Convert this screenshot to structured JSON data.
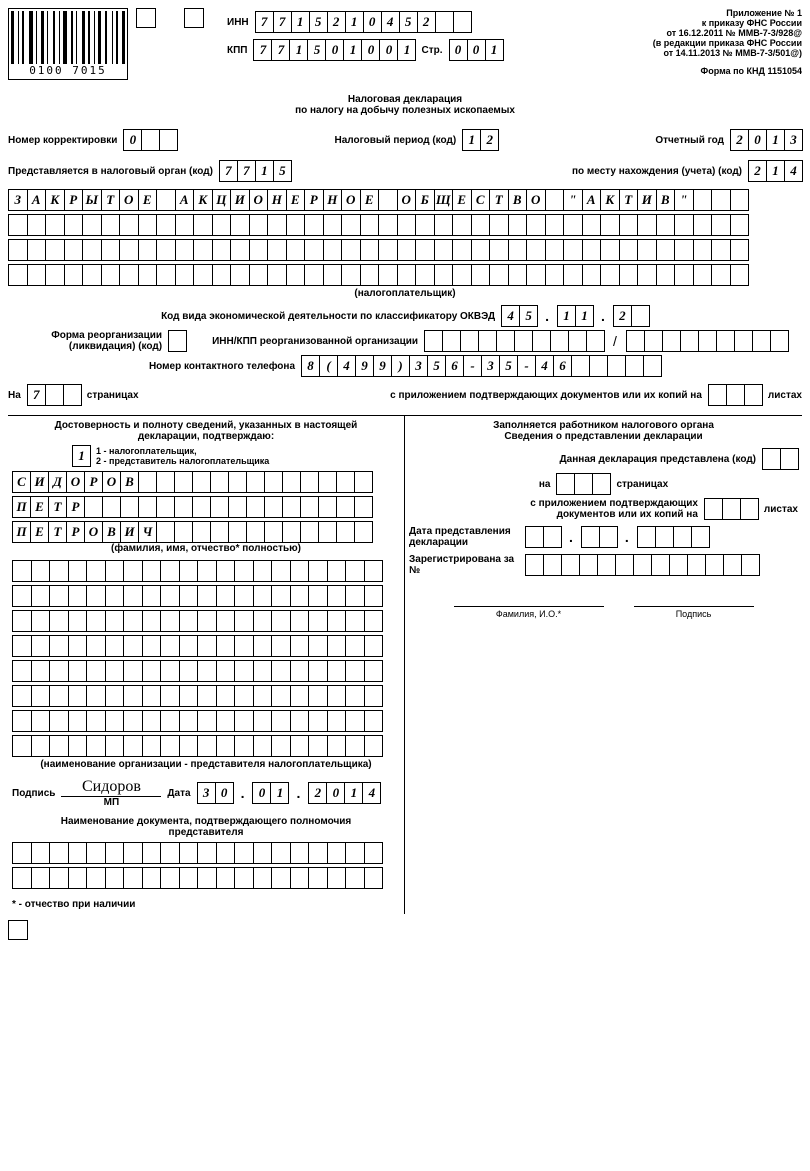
{
  "barcode_number": "0100 7015",
  "header": {
    "inn_label": "ИНН",
    "inn": [
      "7",
      "7",
      "1",
      "5",
      "2",
      "1",
      "0",
      "4",
      "5",
      "2",
      "",
      ""
    ],
    "kpp_label": "КПП",
    "kpp": [
      "7",
      "7",
      "1",
      "5",
      "0",
      "1",
      "0",
      "0",
      "1"
    ],
    "str_label": "Стр.",
    "str": [
      "0",
      "0",
      "1"
    ],
    "appendix": [
      "Приложение № 1",
      "к приказу ФНС России",
      "от 16.12.2011 № ММВ-7-3/928@",
      "(в редакции приказа ФНС России",
      "от 14.11.2013 № ММВ-7-3/501@)"
    ],
    "form_code": "Форма по КНД 1151054"
  },
  "title1": "Налоговая декларация",
  "title2": "по налогу на добычу полезных ископаемых",
  "corr_label": "Номер корректировки",
  "corr": [
    "0",
    "",
    ""
  ],
  "period_label": "Налоговый период (код)",
  "period": [
    "1",
    "2"
  ],
  "year_label": "Отчетный год",
  "year": [
    "2",
    "0",
    "1",
    "3"
  ],
  "organ_label": "Представляется в налоговый орган (код)",
  "organ": [
    "7",
    "7",
    "1",
    "5"
  ],
  "place_label": "по месту нахождения (учета) (код)",
  "place": [
    "2",
    "1",
    "4"
  ],
  "name_rows": [
    [
      "З",
      "А",
      "К",
      "Р",
      "Ы",
      "Т",
      "О",
      "Е",
      "",
      "А",
      "К",
      "Ц",
      "И",
      "О",
      "Н",
      "Е",
      "Р",
      "Н",
      "О",
      "Е",
      "",
      "О",
      "Б",
      "Щ",
      "Е",
      "С",
      "Т",
      "В",
      "О",
      "",
      "\"",
      "А",
      "К",
      "Т",
      "И",
      "В",
      "\"",
      "",
      "",
      ""
    ],
    [
      "",
      "",
      "",
      "",
      "",
      "",
      "",
      "",
      "",
      "",
      "",
      "",
      "",
      "",
      "",
      "",
      "",
      "",
      "",
      "",
      "",
      "",
      "",
      "",
      "",
      "",
      "",
      "",
      "",
      "",
      "",
      "",
      "",
      "",
      "",
      "",
      "",
      "",
      "",
      ""
    ],
    [
      "",
      "",
      "",
      "",
      "",
      "",
      "",
      "",
      "",
      "",
      "",
      "",
      "",
      "",
      "",
      "",
      "",
      "",
      "",
      "",
      "",
      "",
      "",
      "",
      "",
      "",
      "",
      "",
      "",
      "",
      "",
      "",
      "",
      "",
      "",
      "",
      "",
      "",
      "",
      ""
    ],
    [
      "",
      "",
      "",
      "",
      "",
      "",
      "",
      "",
      "",
      "",
      "",
      "",
      "",
      "",
      "",
      "",
      "",
      "",
      "",
      "",
      "",
      "",
      "",
      "",
      "",
      "",
      "",
      "",
      "",
      "",
      "",
      "",
      "",
      "",
      "",
      "",
      "",
      "",
      "",
      ""
    ]
  ],
  "taxpayer_note": "(налогоплательщик)",
  "okved_label": "Код вида экономической деятельности по классификатору ОКВЭД",
  "okved": [
    [
      "4",
      "5"
    ],
    [
      "1",
      "1"
    ],
    [
      "2",
      ""
    ]
  ],
  "reorg_label": "Форма реорганизации (ликвидация) (код)",
  "inn_kpp_reorg_label": "ИНН/КПП реорганизованной организации",
  "reorg_inn": [
    "",
    "",
    "",
    "",
    "",
    "",
    "",
    "",
    "",
    ""
  ],
  "reorg_kpp": [
    "",
    "",
    "",
    "",
    "",
    "",
    "",
    "",
    ""
  ],
  "phone_label": "Номер контактного телефона",
  "phone": [
    "8",
    "(",
    "4",
    "9",
    "9",
    ")",
    "3",
    "5",
    "6",
    "-",
    "3",
    "5",
    "-",
    "4",
    "6",
    "",
    "",
    "",
    "",
    ""
  ],
  "pages_on_label": "На",
  "pages_on": [
    "7",
    "",
    ""
  ],
  "pages_word": "страницах",
  "attach_label": "с приложением подтверждающих документов или их копий на",
  "attach": [
    "",
    "",
    ""
  ],
  "sheets_word": "листах",
  "left": {
    "title": "Достоверность и полноту сведений, указанных в настоящей декларации, подтверждаю:",
    "who": [
      "1"
    ],
    "who_opt1": "1 - налогоплательщик,",
    "who_opt2": "2 - представитель налогоплательщика",
    "fio1": [
      "С",
      "И",
      "Д",
      "О",
      "Р",
      "О",
      "В",
      "",
      "",
      "",
      "",
      "",
      "",
      "",
      "",
      "",
      "",
      "",
      "",
      ""
    ],
    "fio2": [
      "П",
      "Е",
      "Т",
      "Р",
      "",
      "",
      "",
      "",
      "",
      "",
      "",
      "",
      "",
      "",
      "",
      "",
      "",
      "",
      "",
      ""
    ],
    "fio3": [
      "П",
      "Е",
      "Т",
      "Р",
      "О",
      "В",
      "И",
      "Ч",
      "",
      "",
      "",
      "",
      "",
      "",
      "",
      "",
      "",
      "",
      "",
      ""
    ],
    "fio_note": "(фамилия, имя, отчество* полностью)",
    "org_rows": [
      [
        "",
        "",
        "",
        "",
        "",
        "",
        "",
        "",
        "",
        "",
        "",
        "",
        "",
        "",
        "",
        "",
        "",
        "",
        "",
        ""
      ],
      [
        "",
        "",
        "",
        "",
        "",
        "",
        "",
        "",
        "",
        "",
        "",
        "",
        "",
        "",
        "",
        "",
        "",
        "",
        "",
        ""
      ],
      [
        "",
        "",
        "",
        "",
        "",
        "",
        "",
        "",
        "",
        "",
        "",
        "",
        "",
        "",
        "",
        "",
        "",
        "",
        "",
        ""
      ],
      [
        "",
        "",
        "",
        "",
        "",
        "",
        "",
        "",
        "",
        "",
        "",
        "",
        "",
        "",
        "",
        "",
        "",
        "",
        "",
        ""
      ],
      [
        "",
        "",
        "",
        "",
        "",
        "",
        "",
        "",
        "",
        "",
        "",
        "",
        "",
        "",
        "",
        "",
        "",
        "",
        "",
        ""
      ],
      [
        "",
        "",
        "",
        "",
        "",
        "",
        "",
        "",
        "",
        "",
        "",
        "",
        "",
        "",
        "",
        "",
        "",
        "",
        "",
        ""
      ],
      [
        "",
        "",
        "",
        "",
        "",
        "",
        "",
        "",
        "",
        "",
        "",
        "",
        "",
        "",
        "",
        "",
        "",
        "",
        "",
        ""
      ],
      [
        "",
        "",
        "",
        "",
        "",
        "",
        "",
        "",
        "",
        "",
        "",
        "",
        "",
        "",
        "",
        "",
        "",
        "",
        "",
        ""
      ]
    ],
    "org_note": "(наименование организации - представителя налогоплательщика)",
    "sign_label": "Подпись",
    "signature": "Сидоров",
    "mp": "МП",
    "date_label": "Дата",
    "date_d": [
      "3",
      "0"
    ],
    "date_m": [
      "0",
      "1"
    ],
    "date_y": [
      "2",
      "0",
      "1",
      "4"
    ],
    "doc_label": "Наименование документа, подтверждающего полномочия представителя",
    "doc_rows": [
      [
        "",
        "",
        "",
        "",
        "",
        "",
        "",
        "",
        "",
        "",
        "",
        "",
        "",
        "",
        "",
        "",
        "",
        "",
        "",
        ""
      ],
      [
        "",
        "",
        "",
        "",
        "",
        "",
        "",
        "",
        "",
        "",
        "",
        "",
        "",
        "",
        "",
        "",
        "",
        "",
        "",
        ""
      ]
    ],
    "footnote": "* - отчество при наличии"
  },
  "right": {
    "title1": "Заполняется работником налогового органа",
    "title2": "Сведения о представлении декларации",
    "present_label": "Данная декларация представлена (код)",
    "present": [
      "",
      ""
    ],
    "on_label": "на",
    "on_pages": [
      "",
      "",
      ""
    ],
    "pages_word": "страницах",
    "attach_label": "с приложением подтверждающих документов или их копий на",
    "attach": [
      "",
      "",
      ""
    ],
    "sheets_word": "листах",
    "date_label": "Дата представления декларации",
    "date_d": [
      "",
      ""
    ],
    "date_m": [
      "",
      ""
    ],
    "date_y": [
      "",
      "",
      "",
      ""
    ],
    "reg_label": "Зарегистрирована за №",
    "reg": [
      "",
      "",
      "",
      "",
      "",
      "",
      "",
      "",
      "",
      "",
      "",
      "",
      ""
    ],
    "fio_label": "Фамилия, И.О.*",
    "sign_label": "Подпись"
  }
}
